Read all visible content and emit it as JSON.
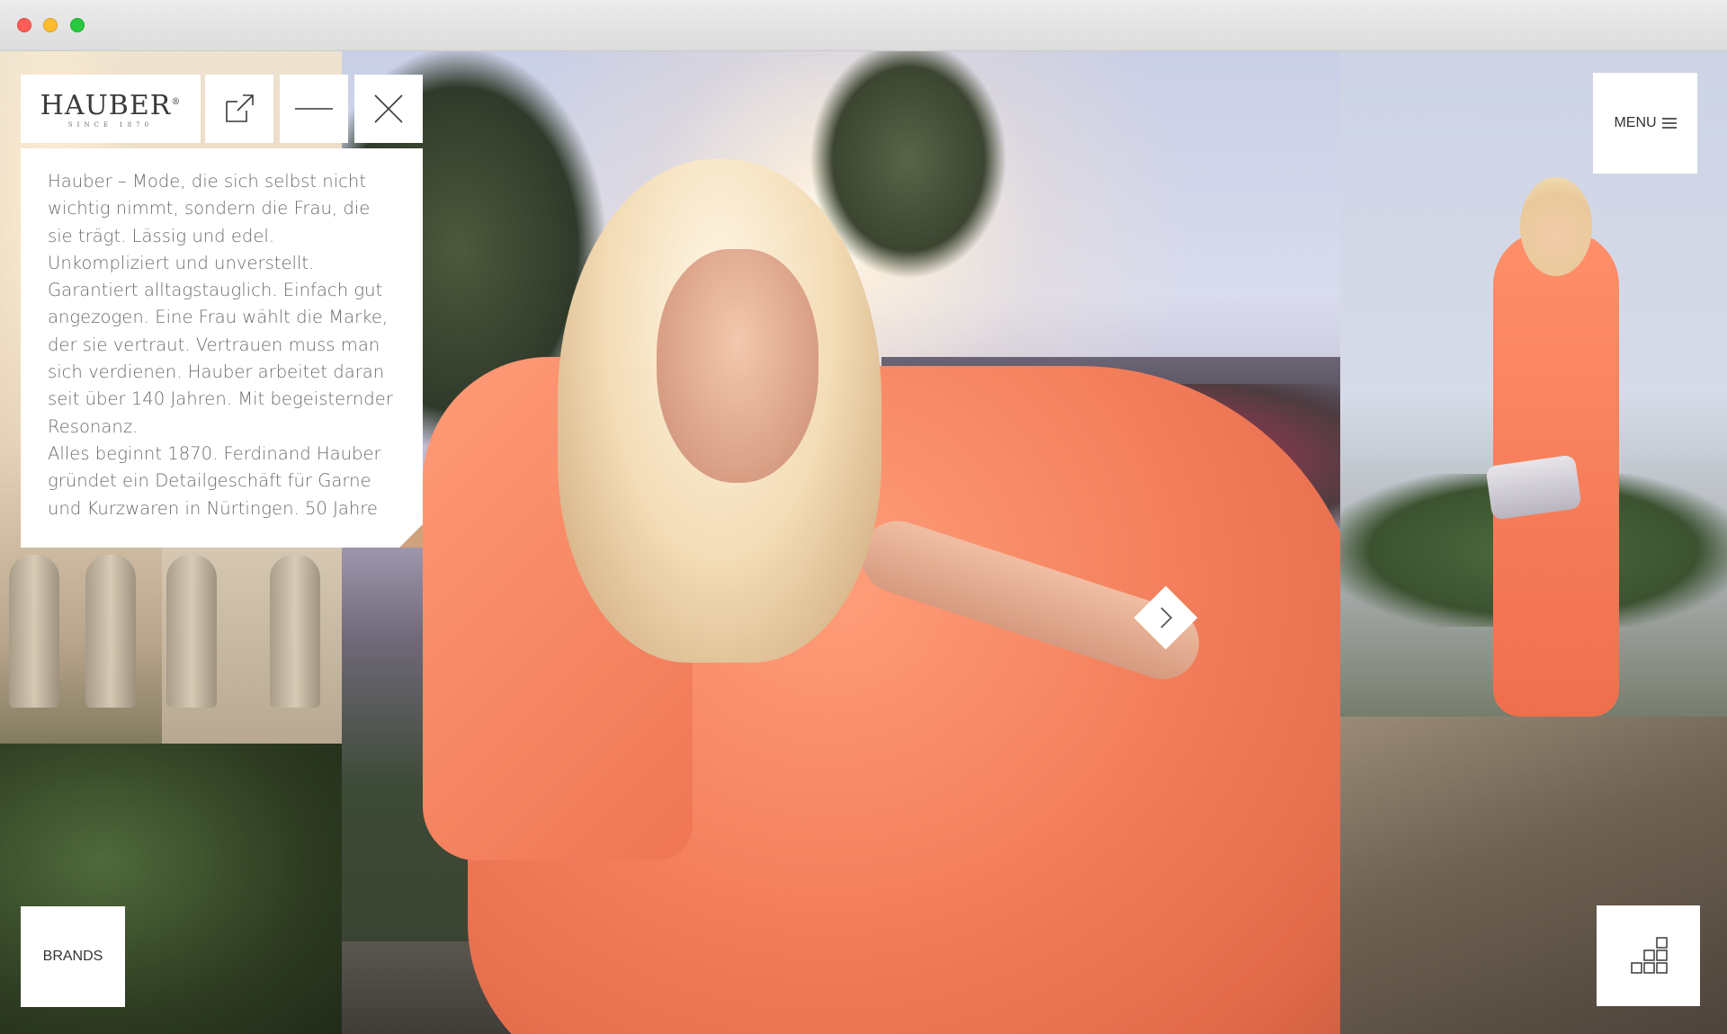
{
  "brand": {
    "logo_text": "HAUBER",
    "logo_registered": "®",
    "logo_sub": "SINCE 1870"
  },
  "toolbar": {
    "open_external_icon": "external-link-icon",
    "minimize_icon": "minimize-icon",
    "close_icon": "close-icon"
  },
  "intro": {
    "text": "Hauber – Mode, die sich selbst nicht wichtig nimmt, sondern die Frau, die sie trägt. Lässig und edel. Unkompliziert und unverstellt. Garantiert alltagstauglich. Einfach gut angezogen. Eine Frau wählt die Marke, der sie vertraut. Vertrauen muss man sich verdienen. Hauber arbeitet daran seit über 140 Jahren. Mit begeisternder Resonanz.",
    "text2": "Alles beginnt 1870. Ferdinand Hauber gründet ein Detailgeschäft für Garne und Kurzwaren in Nürtingen. 50 Jahre"
  },
  "menu": {
    "label": "MENU",
    "icon": "hamburger-icon"
  },
  "brands": {
    "label": "BRANDS"
  },
  "gallery": {
    "next_icon": "chevron-right-icon",
    "grid_icon": "grid-stack-icon"
  },
  "colors": {
    "panel_bg": "#ffffff",
    "text": "#6b6b6b",
    "dress": "#f47f5c"
  }
}
